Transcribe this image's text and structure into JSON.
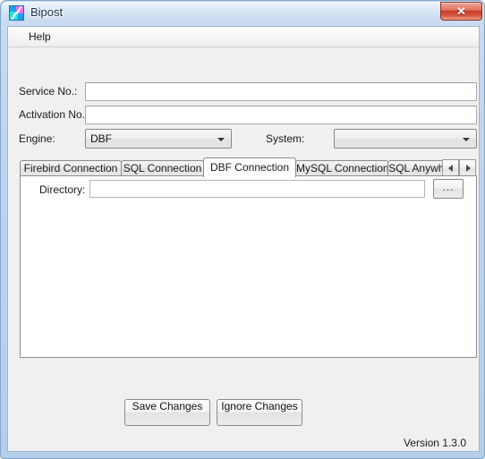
{
  "window": {
    "title": "Bipost",
    "icon": "bipost-logo-icon",
    "close_label": "✕"
  },
  "menubar": {
    "items": [
      {
        "label": "Help"
      }
    ]
  },
  "form": {
    "service_no": {
      "label": "Service No.:",
      "value": "",
      "placeholder": ""
    },
    "activation_no": {
      "label": "Activation No.:",
      "value": "",
      "placeholder": ""
    },
    "engine": {
      "label": "Engine:",
      "selected": "DBF",
      "options": [
        "DBF"
      ]
    },
    "system": {
      "label": "System:",
      "selected": "",
      "options": []
    }
  },
  "tabs": {
    "items": [
      {
        "label": "Firebird Connection",
        "active": false
      },
      {
        "label": "SQL Connection",
        "active": false
      },
      {
        "label": "DBF Connection",
        "active": true
      },
      {
        "label": "MySQL Connection",
        "active": false
      },
      {
        "label": "SQL Anywhere",
        "active": false
      }
    ],
    "scroll_prev": "◀",
    "scroll_next": "▶"
  },
  "tabpage": {
    "directory": {
      "label": "Directory:",
      "value": "",
      "placeholder": "",
      "browse_label": "..."
    }
  },
  "actions": {
    "save_label": "Save Changes",
    "ignore_label": "Ignore Changes"
  },
  "footer": {
    "version": "Version 1.3.0"
  },
  "colors": {
    "frame": "#bed4ec",
    "client": "#f0f0f0",
    "close_button": "#c33c27",
    "icon_blue": "#1d9fe8",
    "icon_cyan": "#23e3e0",
    "icon_pink": "#f06ae8"
  }
}
